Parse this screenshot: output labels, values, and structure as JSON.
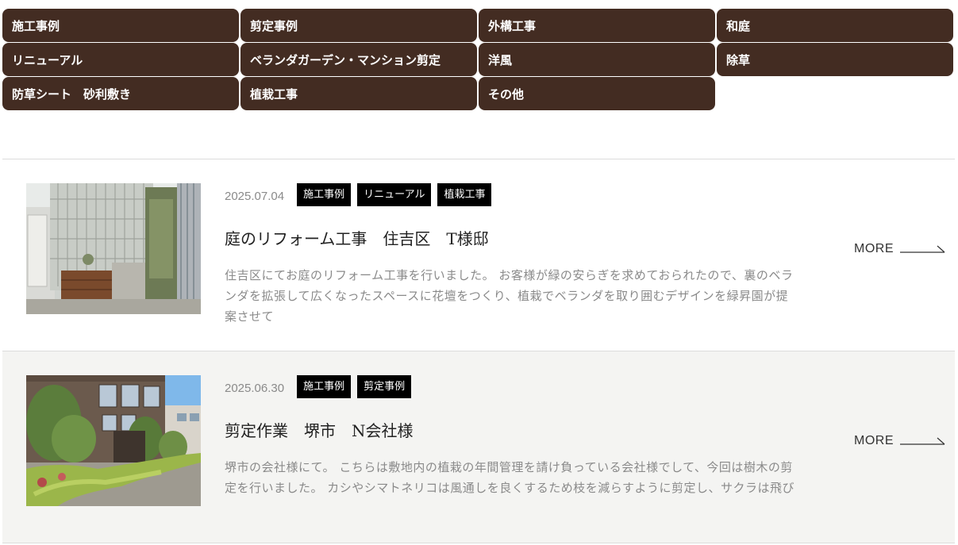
{
  "categories": [
    "施工事例",
    "剪定事例",
    "外構工事",
    "和庭",
    "リニューアル",
    "ベランダガーデン・マンション剪定",
    "洋風",
    "除草",
    "防草シート　砂利敷き",
    "植栽工事",
    "その他"
  ],
  "posts": [
    {
      "date": "2025.07.04",
      "tags": [
        "施工事例",
        "リニューアル",
        "植栽工事"
      ],
      "title": "庭のリフォーム工事　住吉区　T様邸",
      "excerpt": "住吉区にてお庭のリフォーム工事を行いました。 お客様が緑の安らぎを求めておられたので、裏のベランダを拡張して広くなったスペースに花壇をつくり、植栽でベランダを取り囲むデザインを緑昇園が提案させて",
      "more": "MORE"
    },
    {
      "date": "2025.06.30",
      "tags": [
        "施工事例",
        "剪定事例"
      ],
      "title": "剪定作業　堺市　N会社様",
      "excerpt": "堺市の会社様にて。 こちらは敷地内の植栽の年間管理を請け負っている会社様でして、今回は樹木の剪定を行いました。 カシやシマトネリコは風通しを良くするため枝を減らすように剪定し、サクラは飛び",
      "more": "MORE"
    }
  ],
  "colors": {
    "category_bg": "#432c22",
    "tag_bg": "#000000",
    "alt_row_bg": "#f4f4f2"
  }
}
